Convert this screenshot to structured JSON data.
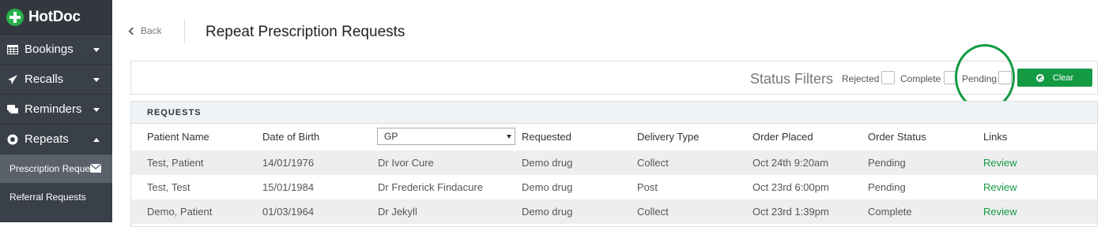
{
  "app": {
    "name": "HotDoc"
  },
  "sidebar": {
    "items": [
      {
        "label": "Bookings",
        "icon": "table-icon"
      },
      {
        "label": "Recalls",
        "icon": "paper-plane-icon"
      },
      {
        "label": "Reminders",
        "icon": "comments-icon"
      },
      {
        "label": "Repeats",
        "icon": "record-icon"
      }
    ],
    "sub_items": [
      {
        "label": "Prescription Reques"
      },
      {
        "label": "Referral Requests"
      }
    ]
  },
  "header": {
    "back_label": "Back",
    "title": "Repeat Prescription Requests"
  },
  "filters": {
    "title": "Status Filters",
    "options": [
      {
        "label": "Rejected",
        "checked": false
      },
      {
        "label": "Complete",
        "checked": false
      },
      {
        "label": "Pending",
        "checked": false
      }
    ],
    "clear_label": "Clear"
  },
  "requests": {
    "heading": "REQUESTS",
    "columns": [
      "Patient Name",
      "Date of Birth",
      "GP",
      "Requested",
      "Delivery Type",
      "Order Placed",
      "Order Status",
      "Links"
    ],
    "gp_select_value": "GP",
    "rows": [
      {
        "patient": "Test, Patient",
        "dob": "14/01/1976",
        "gp": "Dr Ivor Cure",
        "requested": "Demo drug",
        "delivery": "Collect",
        "placed": "Oct 24th 9:20am",
        "status": "Pending",
        "link": "Review"
      },
      {
        "patient": "Test, Test",
        "dob": "15/01/1984",
        "gp": "Dr Frederick Findacure",
        "requested": "Demo drug",
        "delivery": "Post",
        "placed": "Oct 23rd 6:00pm",
        "status": "Pending",
        "link": "Review"
      },
      {
        "patient": "Demo, Patient",
        "dob": "01/03/1964",
        "gp": "Dr Jekyll",
        "requested": "Demo drug",
        "delivery": "Collect",
        "placed": "Oct 23rd 1:39pm",
        "status": "Complete",
        "link": "Review"
      }
    ]
  },
  "colors": {
    "accent": "#139a43",
    "sidebar": "#3a4049"
  }
}
